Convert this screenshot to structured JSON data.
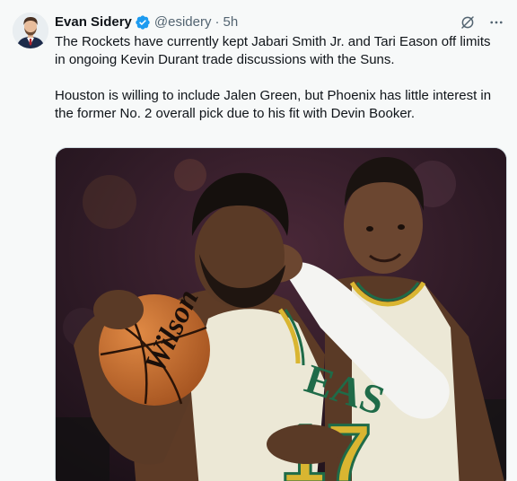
{
  "tweet": {
    "author": {
      "display_name": "Evan Sidery",
      "handle": "@esidery",
      "verified": true,
      "avatar_icon": "profile-avatar"
    },
    "separator": "·",
    "timestamp": "5h",
    "paragraphs": [
      "The Rockets have currently kept Jabari Smith Jr. and Tari Eason off limits in ongoing Kevin Durant trade discussions with the Suns.",
      "Houston is willing to include Jalen Green, but Phoenix has little interest in the former No. 2 overall pick due to his fit with Devin Booker."
    ],
    "actions": {
      "grok_icon": "grok-icon",
      "more_icon": "more-icon"
    },
    "media": {
      "type": "photo",
      "jersey_text": "EAS",
      "jersey_number": "17",
      "ball_brand": "Wilson"
    }
  },
  "colors": {
    "background": "#f7f9f9",
    "text_primary": "#0f1419",
    "text_secondary": "#536471",
    "verified_blue": "#1d9bf0",
    "jersey_cream": "#ece8d6",
    "jersey_gold": "#d9b531",
    "jersey_green": "#1f6b48"
  }
}
